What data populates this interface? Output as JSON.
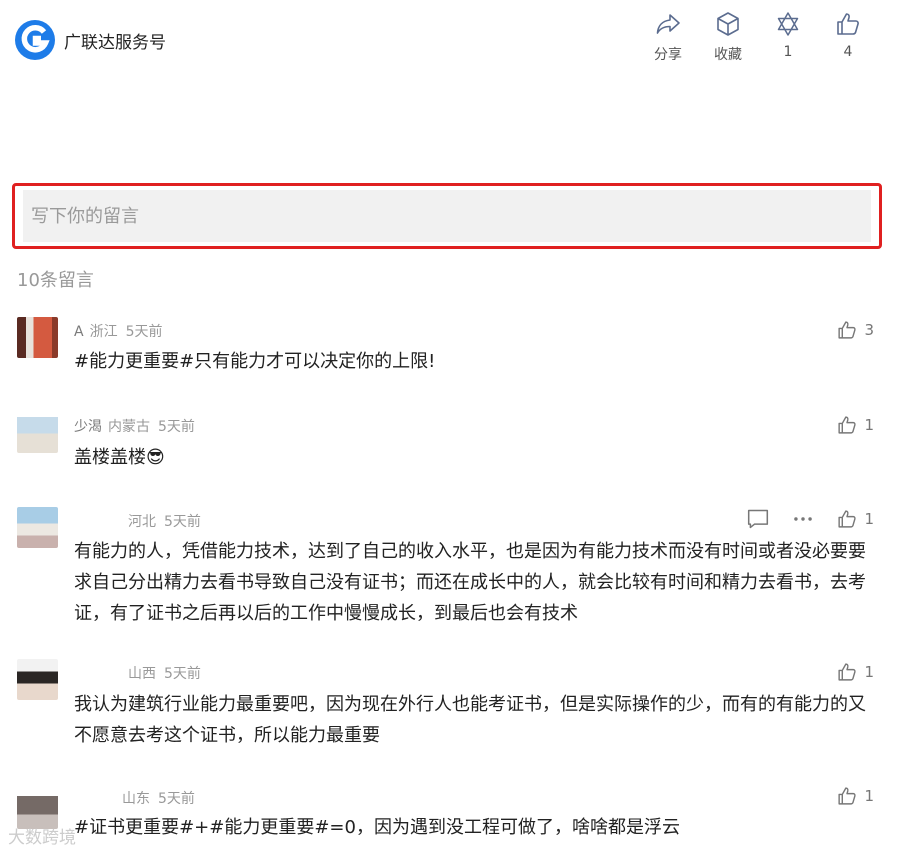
{
  "header": {
    "account_name": "广联达服务号",
    "actions": [
      {
        "icon": "share-icon",
        "label": "分享"
      },
      {
        "icon": "favorite-box-icon",
        "label": "收藏"
      },
      {
        "icon": "star-of-david-icon",
        "label": "1"
      },
      {
        "icon": "thumbs-up-icon",
        "label": "4"
      }
    ]
  },
  "comment_box": {
    "placeholder": "写下你的留言"
  },
  "comment_count": "10条留言",
  "comments": [
    {
      "name": "A",
      "location": "浙江",
      "time": "5天前",
      "text": "#能力更重要#只有能力才可以决定你的上限!",
      "likes": "3"
    },
    {
      "name": "少渴",
      "location": "内蒙古",
      "time": "5天前",
      "text": "盖楼盖楼😎",
      "likes": "1"
    },
    {
      "name": "",
      "location": "河北",
      "time": "5天前",
      "text": "有能力的人，凭借能力技术，达到了自己的收入水平，也是因为有能力技术而没有时间或者没必要要求自己分出精力去看书导致自己没有证书；而还在成长中的人，就会比较有时间和精力去看书，去考证，有了证书之后再以后的工作中慢慢成长，到最后也会有技术",
      "likes": "1"
    },
    {
      "name": "",
      "location": "山西",
      "time": "5天前",
      "text": "我认为建筑行业能力最重要吧，因为现在外行人也能考证书，但是实际操作的少，而有的有能力的又不愿意去考这个证书，所以能力最重要",
      "likes": "1"
    },
    {
      "name": "",
      "location": "山东",
      "time": "5天前",
      "text": "#证书更重要#+#能力更重要#=0，因为遇到没工程可做了，啥啥都是浮云",
      "likes": "1"
    }
  ],
  "watermark": "大数跨境",
  "colors": {
    "brand_blue": "#1e7ce8",
    "highlight_red": "#e02020"
  }
}
